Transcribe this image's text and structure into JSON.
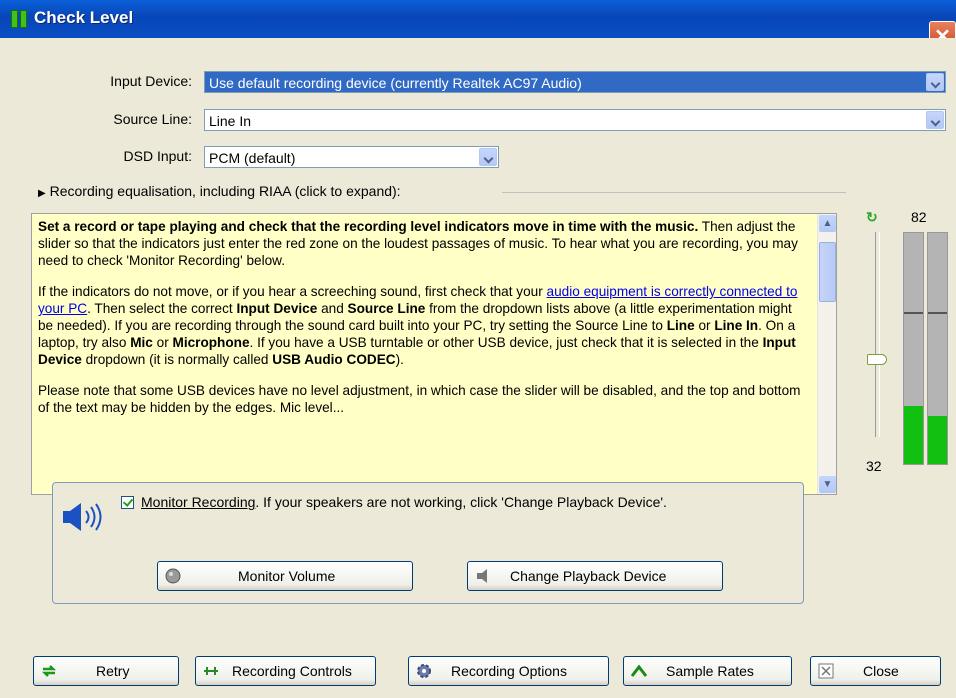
{
  "window": {
    "title": "Check Level",
    "close_glyph": "✕"
  },
  "input_device": {
    "label": "Input Device:",
    "value": "Use default recording device (currently Realtek AC97 Audio)"
  },
  "source_line": {
    "label": "Source Line:",
    "value": "Line In"
  },
  "dsd_input": {
    "label": "DSD Input:",
    "value": "PCM (default)"
  },
  "equalisation": {
    "label": "Recording equalisation, including RIAA (click to expand):"
  },
  "help": {
    "p1_bold": "Set a record or tape playing and check that the recording level indicators move in time with the music.",
    "p1_rest": "  Then adjust the slider so that the indicators just enter the red zone on the loudest passages of music.  To hear what you are recording, you may need to check 'Monitor Recording' below.",
    "p2_a": "If the indicators do not move, or if you hear a screeching sound, first check that your ",
    "p2_link": "audio equipment is correctly connected to your PC",
    "p2_b": ".  Then select the correct ",
    "p2_b1": "Input Device",
    "p2_c": " and ",
    "p2_b2": "Source Line",
    "p2_d": " from the dropdown lists above (a little experimentation might be needed).  If you are recording through the sound card built into your PC, try setting the Source Line to ",
    "p2_b3": "Line",
    "p2_e": " or ",
    "p2_b4": "Line In",
    "p2_f": ".  On a laptop, try also ",
    "p2_b5": "Mic",
    "p2_g": " or ",
    "p2_b6": "Microphone",
    "p2_h": ".  If you have a USB turntable or other USB device, just check that it is selected in the ",
    "p2_b7": "Input Device",
    "p2_i": " dropdown (it is normally called ",
    "p2_b8": "USB Audio CODEC",
    "p2_j": ").",
    "p3": "Please note that some USB devices have no level adjustment, in which case the slider will be disabled, and the top and bottom of the text may be hidden by the edges. Mic level..."
  },
  "level": {
    "max_label": "82",
    "min_label": "32",
    "slider_fraction": 0.38,
    "meters": [
      {
        "level": 0.25,
        "peak": 0.66
      },
      {
        "level": 0.21,
        "peak": 0.66
      }
    ]
  },
  "monitor": {
    "checkbox_label": "Monitor Recording",
    "text": ".  If your speakers are not working, click 'Change Playback Device'.",
    "checked": true,
    "volume_button": "Monitor Volume",
    "playback_button": "Change Playback Device"
  },
  "buttons": {
    "retry": "Retry",
    "recording_controls": "Recording Controls",
    "recording_options": "Recording Options",
    "sample_rates": "Sample Rates",
    "close": "Close"
  },
  "colors": {
    "meter_green": "#12c012",
    "title_blue": "#0846b8",
    "help_bg": "#ffffc6"
  }
}
